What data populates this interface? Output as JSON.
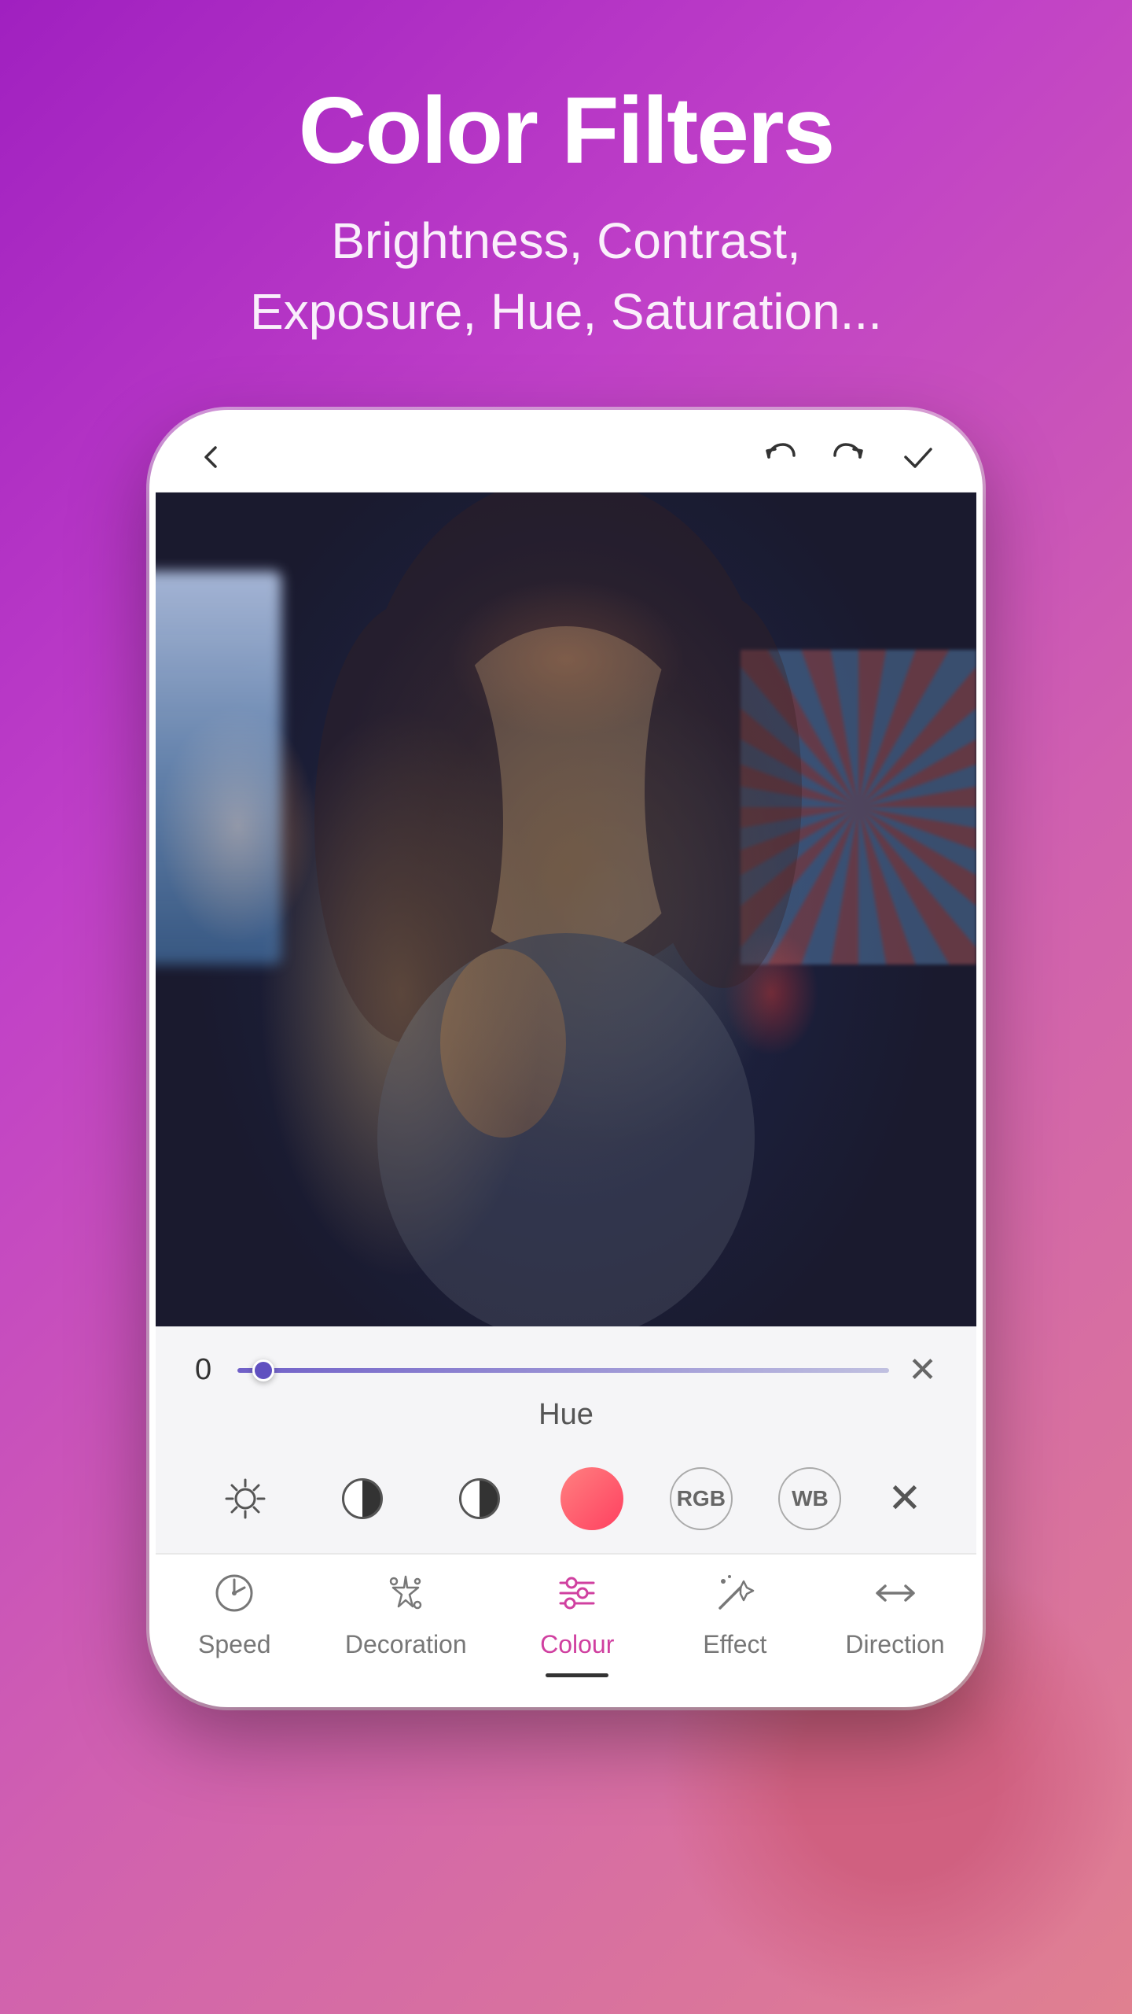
{
  "page": {
    "title": "Color Filters",
    "subtitle_line1": "Brightness, Contrast,",
    "subtitle_line2": "Exposure, Hue, Saturation..."
  },
  "phone": {
    "nav": {
      "back_icon": "‹",
      "undo_icon": "↺",
      "redo_icon": "↻",
      "check_icon": "✓"
    },
    "slider": {
      "value": "0",
      "label": "Hue",
      "thumb_position_percent": 4
    },
    "filter_icons": [
      {
        "name": "brightness",
        "symbol": "☀"
      },
      {
        "name": "contrast",
        "symbol": "half"
      },
      {
        "name": "exposure",
        "symbol": "yinyang"
      },
      {
        "name": "hue",
        "symbol": "pink"
      },
      {
        "name": "rgb",
        "symbol": "RGB"
      },
      {
        "name": "wb",
        "symbol": "WB"
      }
    ],
    "bottom_tabs": [
      {
        "id": "speed",
        "label": "Speed",
        "icon": "⏱",
        "active": false
      },
      {
        "id": "decoration",
        "label": "Decoration",
        "icon": "✦",
        "active": false
      },
      {
        "id": "colour",
        "label": "Colour",
        "icon": "⊞",
        "active": true
      },
      {
        "id": "effect",
        "label": "Effect",
        "icon": "✨",
        "active": false
      },
      {
        "id": "direction",
        "label": "Direction",
        "icon": "↔",
        "active": false
      }
    ]
  },
  "colors": {
    "active_tab": "#d040a0",
    "slider_fill": "#7060c8",
    "background_start": "#a020c0",
    "background_end": "#e08090"
  }
}
